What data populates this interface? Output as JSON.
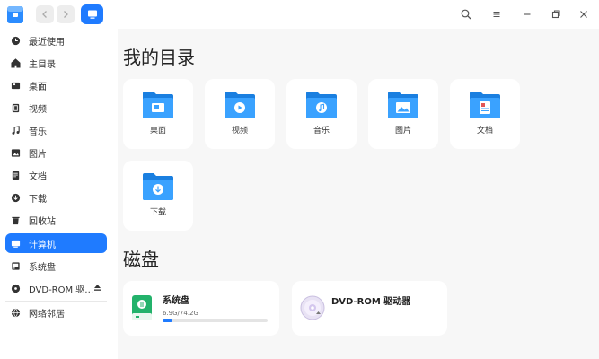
{
  "titlebar": {
    "colors": {
      "accent": "#1f7bff"
    }
  },
  "sidebar": {
    "items": [
      {
        "label": "最近使用",
        "icon": "clock-icon"
      },
      {
        "label": "主目录",
        "icon": "home-icon"
      },
      {
        "label": "桌面",
        "icon": "desktop-icon"
      },
      {
        "label": "视频",
        "icon": "video-icon"
      },
      {
        "label": "音乐",
        "icon": "music-icon"
      },
      {
        "label": "图片",
        "icon": "picture-icon"
      },
      {
        "label": "文档",
        "icon": "document-icon"
      },
      {
        "label": "下载",
        "icon": "download-icon"
      },
      {
        "label": "回收站",
        "icon": "trash-icon"
      },
      {
        "label": "计算机",
        "icon": "computer-icon",
        "active": true
      },
      {
        "label": "系统盘",
        "icon": "disk-icon"
      },
      {
        "label": "DVD-ROM 驱…",
        "icon": "dvd-icon"
      },
      {
        "label": "网络邻居",
        "icon": "network-icon"
      }
    ]
  },
  "main": {
    "my_dirs_title": "我的目录",
    "folders": [
      {
        "label": "桌面",
        "icon": "desktop-folder-icon"
      },
      {
        "label": "视频",
        "icon": "video-folder-icon"
      },
      {
        "label": "音乐",
        "icon": "music-folder-icon"
      },
      {
        "label": "图片",
        "icon": "picture-folder-icon"
      },
      {
        "label": "文档",
        "icon": "document-folder-icon"
      },
      {
        "label": "下载",
        "icon": "download-folder-icon"
      }
    ],
    "disks_title": "磁盘",
    "disks": [
      {
        "name": "系统盘",
        "size": "6.9G/74.2G",
        "usage": 0.093,
        "icon": "system-disk-icon"
      },
      {
        "name": "DVD-ROM 驱动器",
        "icon": "dvd-disc-icon"
      }
    ]
  }
}
